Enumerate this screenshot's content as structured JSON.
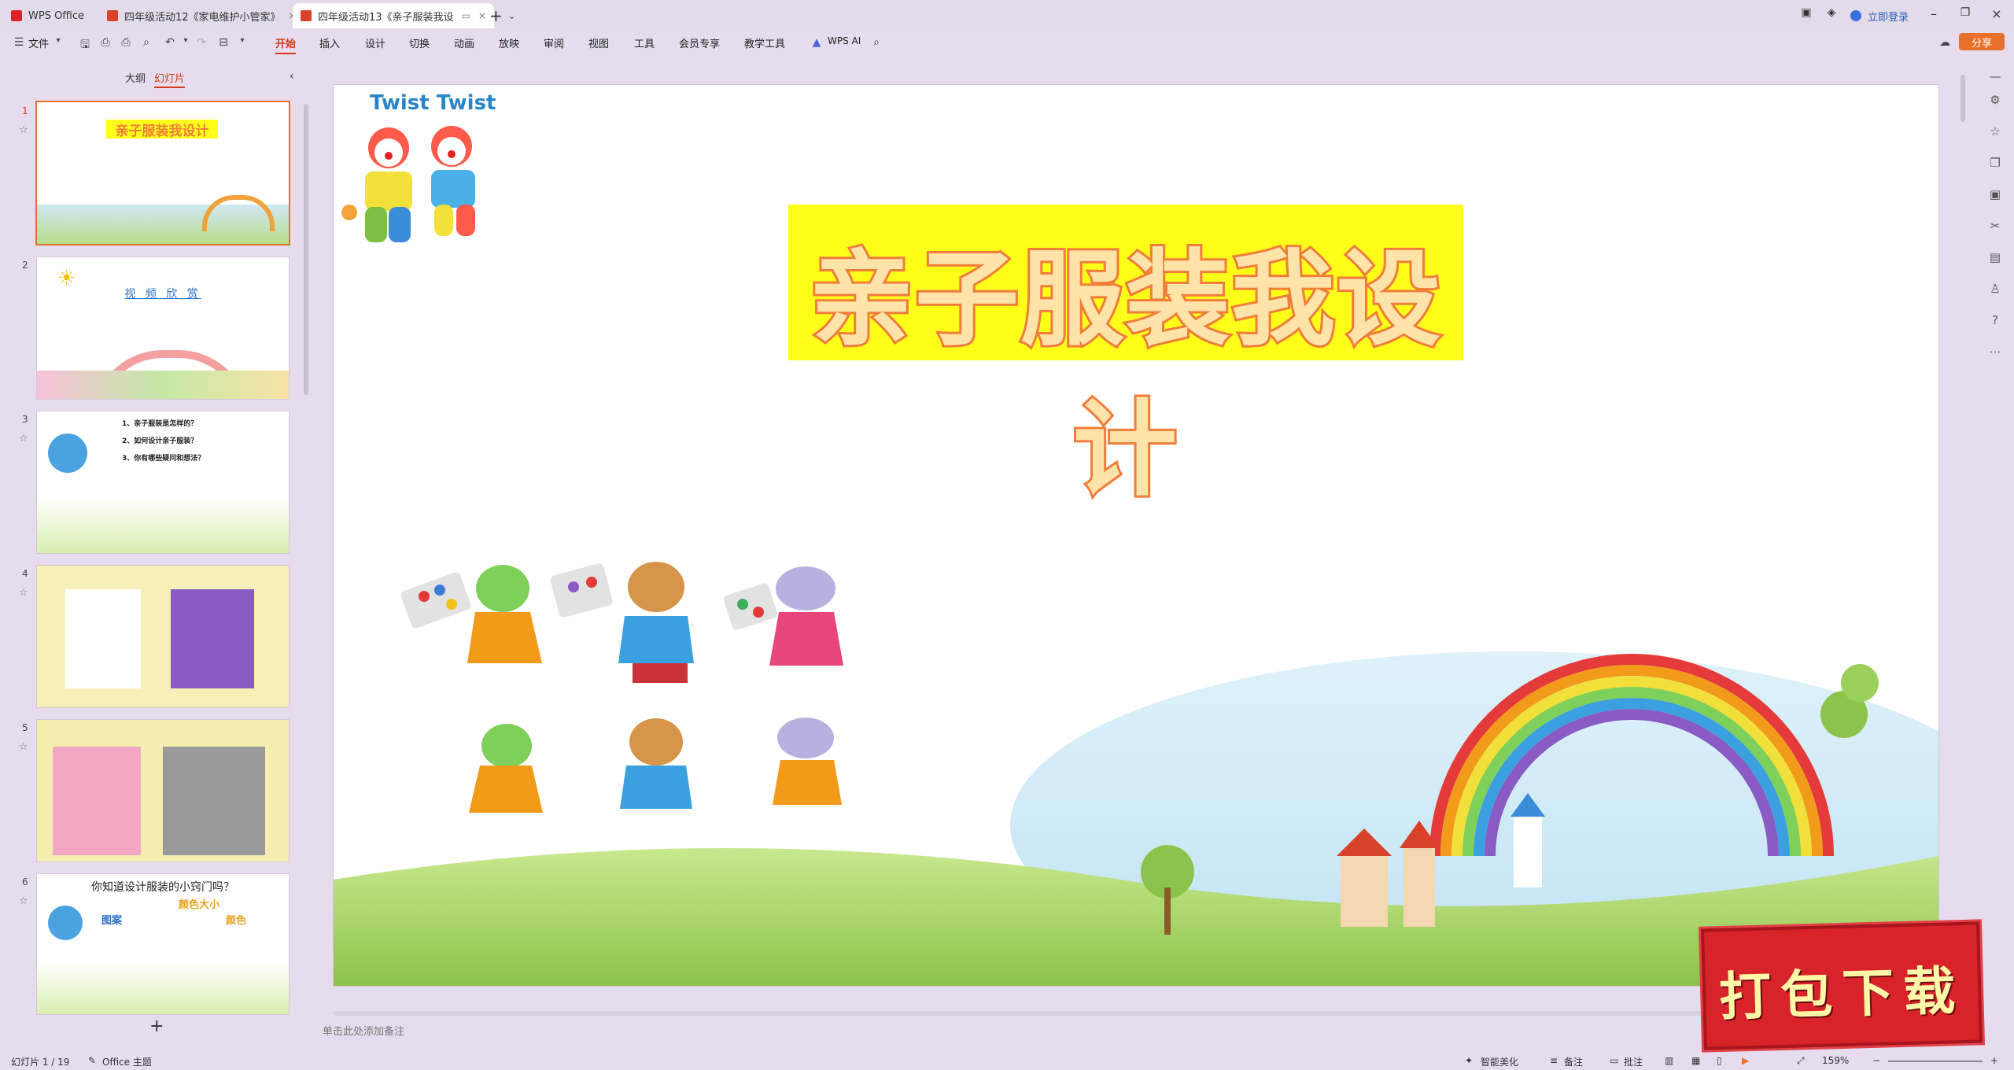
{
  "titlebar": {
    "tabs": [
      {
        "label": "WPS Office",
        "icon": "wps-logo-icon",
        "color": "#d9232b"
      },
      {
        "label": "四年级活动12《家电维护小管家》",
        "icon": "ppt-file-icon",
        "color": "#d8412a"
      },
      {
        "label": "四年级活动13《亲子服装我设",
        "icon": "ppt-file-icon",
        "color": "#d8412a"
      }
    ],
    "login_label": "立即登录"
  },
  "toolbar": {
    "file_label": "文件",
    "menus": [
      "开始",
      "插入",
      "设计",
      "切换",
      "动画",
      "放映",
      "审阅",
      "视图",
      "工具",
      "会员专享",
      "教学工具"
    ],
    "active_menu": "开始",
    "ai_label": "WPS AI",
    "share_label": "分享"
  },
  "leftpane": {
    "tab_outline": "大纲",
    "tab_slides": "幻灯片",
    "thumbnails": [
      {
        "num": "1",
        "title": "亲子服装我设计"
      },
      {
        "num": "2",
        "title": "视 频 欣 赏"
      },
      {
        "num": "3",
        "lines": [
          "1、亲子服装是怎样的？",
          "2、如何设计亲子服装？",
          "3、你有哪些疑问和想法？"
        ]
      },
      {
        "num": "4"
      },
      {
        "num": "5"
      },
      {
        "num": "6",
        "title": "你知道设计服装的小窍门吗？",
        "labels": [
          "图案",
          "颜色大小",
          "颜色"
        ]
      }
    ],
    "add_label": "+"
  },
  "slide": {
    "logo_text": "Twist Twist",
    "title": "亲子服装我设计"
  },
  "notes_placeholder": "单击此处添加备注",
  "status": {
    "slide_counter": "幻灯片 1 / 19",
    "theme": "Office 主题",
    "beautify": "智能美化",
    "notes": "备注",
    "comments": "批注",
    "zoom": "159%"
  },
  "badge_text": "打包下载",
  "colors": {
    "accent": "#d23b1a",
    "share": "#e8702c",
    "badge": "#d9232b",
    "title_fill": "#ffff1a"
  }
}
